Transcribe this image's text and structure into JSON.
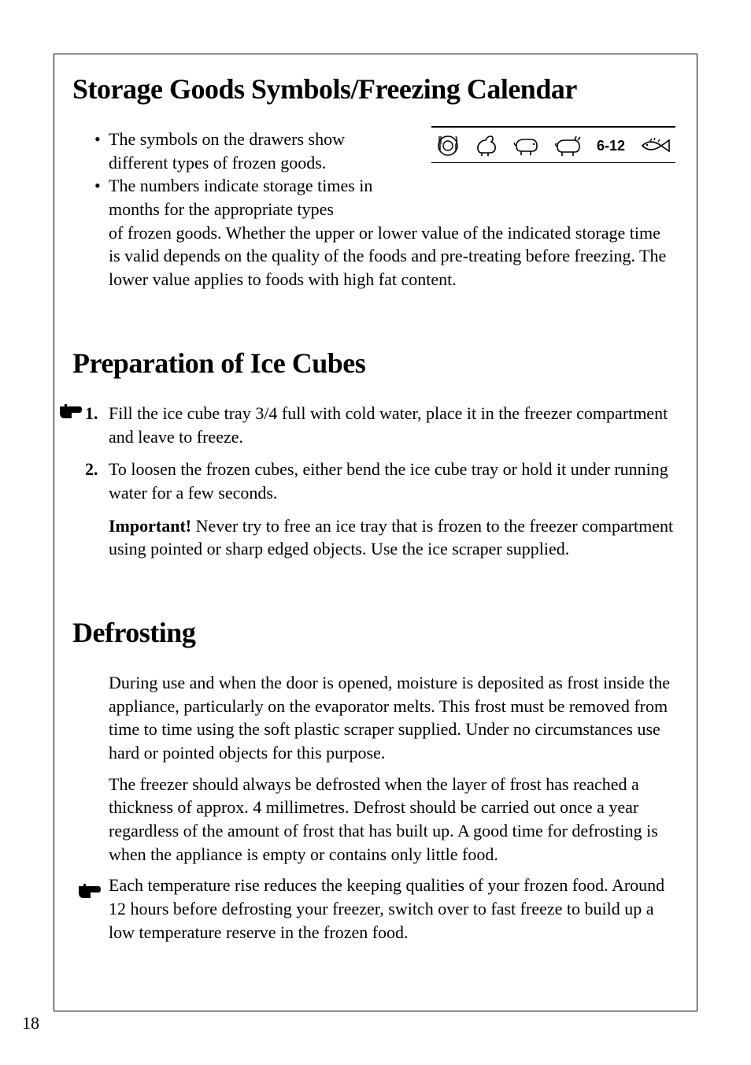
{
  "page_number": "18",
  "section1": {
    "heading": "Storage Goods Symbols/Freezing Calendar",
    "bullet1": "The symbols on the drawers show different types of frozen goods.",
    "bullet2_lead": "The numbers indicate storage times in months for the appropriate types ",
    "bullet2_cont": "of frozen goods. Whether the upper or lower value of the indicated storage time is valid depends on the quality of the foods and pre-treating before freezing. The lower value applies to foods with high fat content.",
    "symbol_range": "6-12"
  },
  "section2": {
    "heading": "Preparation of Ice Cubes",
    "step1_num": "1.",
    "step1": "Fill the ice cube tray 3/4 full with cold water, place it in the freezer compartment and leave to freeze.",
    "step2_num": "2.",
    "step2": "To loosen the frozen cubes, either bend the ice cube tray or hold it under running water for a few seconds.",
    "important_label": "Important!",
    "important_text": " Never try to free an ice tray that is frozen to the freezer compartment using pointed or sharp edged objects. Use the ice scraper supplied."
  },
  "section3": {
    "heading": "Defrosting",
    "p1": "During use and when the door is opened, moisture is deposited as frost inside the appliance, particularly on the evaporator melts. This frost must be removed from time to time using the soft plastic scraper supplied. Under no circumstances use hard or pointed objects for this purpose.",
    "p2": "The freezer should always be defrosted when the layer of frost has reached a thickness of approx. 4 millimetres. Defrost should be carried out once a year regardless of the amount of frost that has built up. A good time for defrosting is when the appliance is empty or contains only little food.",
    "p3": "Each temperature rise reduces the keeping qualities of your frozen food. Around 12 hours before defrosting your freezer, switch over to fast freeze to build up a low temperature reserve in the frozen food."
  }
}
